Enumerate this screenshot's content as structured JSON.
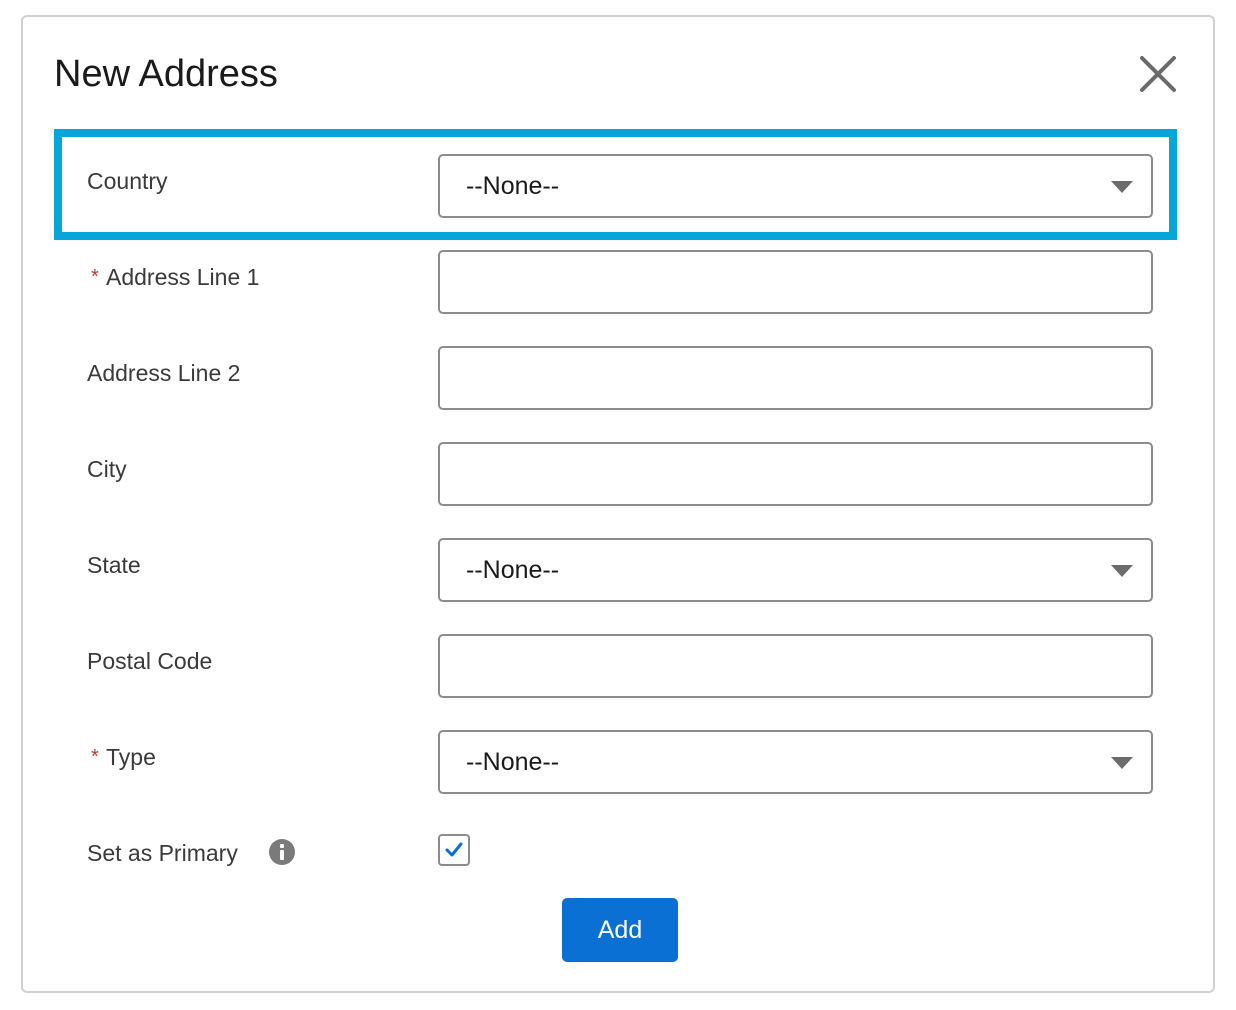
{
  "modal": {
    "title": "New Address"
  },
  "form": {
    "country": {
      "label": "Country",
      "value": "--None--"
    },
    "address_line_1": {
      "label": "Address Line 1",
      "required_marker": "*",
      "value": ""
    },
    "address_line_2": {
      "label": "Address Line 2",
      "value": ""
    },
    "city": {
      "label": "City",
      "value": ""
    },
    "state": {
      "label": "State",
      "value": "--None--"
    },
    "postal_code": {
      "label": "Postal Code",
      "value": ""
    },
    "type": {
      "label": "Type",
      "required_marker": "*",
      "value": "--None--"
    },
    "set_as_primary": {
      "label": "Set as Primary",
      "checked": true
    }
  },
  "actions": {
    "add_label": "Add"
  },
  "icons": {
    "close": "close-icon",
    "dropdown": "chevron-down-icon",
    "info": "info-icon",
    "check": "checkmark-icon"
  },
  "colors": {
    "highlight": "#06a7d8",
    "primary_button": "#0a70d4",
    "required": "#c23934"
  }
}
